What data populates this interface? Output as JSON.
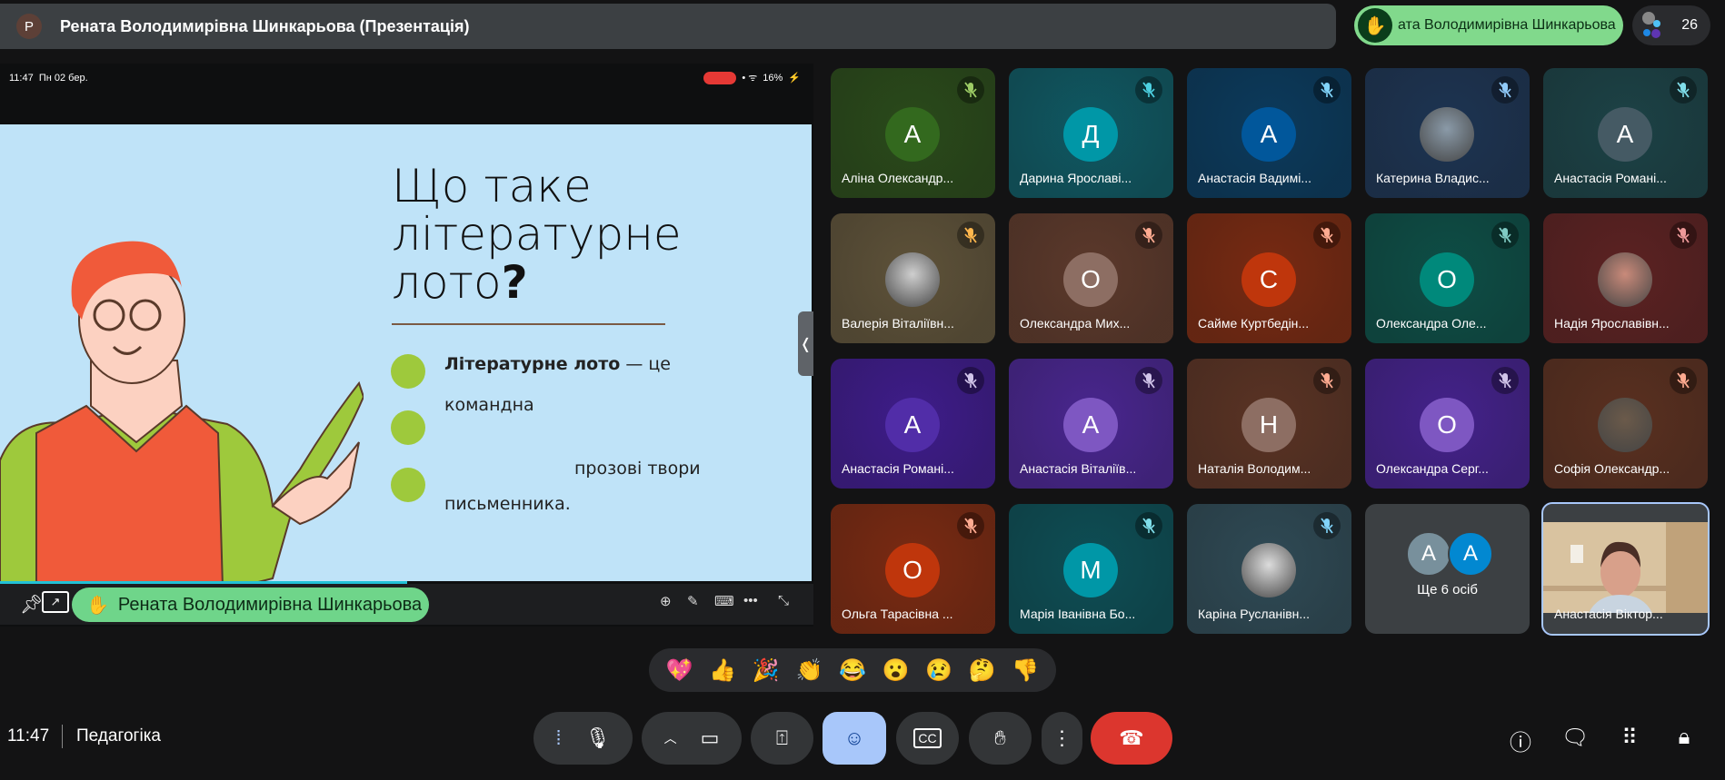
{
  "top": {
    "avatar_letter": "Р",
    "title": "Рената Володимирівна Шинкарьова (Презентація)",
    "raised_hand_name": "ата Володимирівна Шинкарьова",
    "participant_count": "26"
  },
  "presentation": {
    "status_time": "11:47",
    "status_date": "Пн 02 бер.",
    "battery": "16%",
    "slide": {
      "title_line1": "Що таке",
      "title_line2": "літературне",
      "title_line3": "лото",
      "title_q": "?",
      "bullet1_bold": "Літературне лото",
      "bullet1_rest": " — це",
      "line2": "командна",
      "line3": "прозові твори",
      "line4": "письменника."
    },
    "presenter_name": "Рената Володимирівна Шинкарьова"
  },
  "tiles": [
    {
      "name": "Аліна Олександр...",
      "letter": "А",
      "bg": "#2a4a1a",
      "av": "#33691e",
      "tint": "#9ccc65"
    },
    {
      "name": "Дарина Ярославі...",
      "letter": "Д",
      "bg": "#0f5862",
      "av": "#0097a7",
      "tint": "#4dd0e1"
    },
    {
      "name": "Анастасія Вадимі...",
      "letter": "А",
      "bg": "#0b3a5c",
      "av": "#01579b",
      "tint": "#81d4fa"
    },
    {
      "name": "Катерина Владис...",
      "photo": "#8a9aa8",
      "bg": "#1d3452",
      "tint": "#90caf9"
    },
    {
      "name": "Анастасія Романі...",
      "letter": "А",
      "bg": "#1c4246",
      "av": "#455a64",
      "tint": "#80deea"
    },
    {
      "name": "Валерія Віталіївн...",
      "photo": "#cfcfcf",
      "bg": "#5e5239",
      "tint": "#ffb74d"
    },
    {
      "name": "Олександра Мих...",
      "letter": "О",
      "bg": "#5c392b",
      "av": "#8d6e63",
      "tint": "#ffab91"
    },
    {
      "name": "Сайме Куртбедін...",
      "letter": "С",
      "bg": "#782a12",
      "av": "#bf360c",
      "tint": "#ffab91"
    },
    {
      "name": "Олександра Оле...",
      "letter": "О",
      "bg": "#0d4e46",
      "av": "#00897b",
      "tint": "#80cbc4"
    },
    {
      "name": "Надія Ярославівн...",
      "photo": "#c98a7a",
      "bg": "#5c2222",
      "tint": "#ef9a9a"
    },
    {
      "name": "Анастасія Романі...",
      "letter": "А",
      "bg": "#3e1c8a",
      "av": "#512da8",
      "tint": "#d1c4e9"
    },
    {
      "name": "Анастасія Віталіїв...",
      "letter": "А",
      "bg": "#49268f",
      "av": "#7e57c2",
      "tint": "#d1c4e9"
    },
    {
      "name": "Наталія Володим...",
      "letter": "Н",
      "bg": "#5a3324",
      "av": "#8d6e63",
      "tint": "#ffab91"
    },
    {
      "name": "Олександра Серг...",
      "letter": "О",
      "bg": "#44228b",
      "av": "#7e57c2",
      "tint": "#d1c4e9"
    },
    {
      "name": "Софія Олександр...",
      "photo": "#6b5a4a",
      "bg": "#5a3020",
      "tint": "#ffab91"
    },
    {
      "name": "Ольга Тарасівна ...",
      "letter": "О",
      "bg": "#7a2a12",
      "av": "#bf360c",
      "tint": "#ffab91"
    },
    {
      "name": "Марія Іванівна Бо...",
      "letter": "М",
      "bg": "#0d4e55",
      "av": "#0097a7",
      "tint": "#80deea"
    },
    {
      "name": "Каріна Русланівн...",
      "photo": "#dcdcdc",
      "bg": "#2f4a55",
      "tint": "#81d4fa"
    }
  ],
  "more": {
    "label": "Ще 6 осіб",
    "letters": [
      "А",
      "А"
    ],
    "colors": [
      "#78909c",
      "#0288d1"
    ]
  },
  "self": {
    "name": "Анастасія Віктор..."
  },
  "reactions": [
    "💖",
    "👍",
    "🎉",
    "👏",
    "😂",
    "😮",
    "😢",
    "🤔",
    "👎"
  ],
  "bottom": {
    "time": "11:47",
    "meeting": "Педагогіка"
  },
  "colors": {
    "end_call": "#dc362e",
    "emoji_active": "#a8c7fa",
    "raised_hand": "#81d98c"
  }
}
